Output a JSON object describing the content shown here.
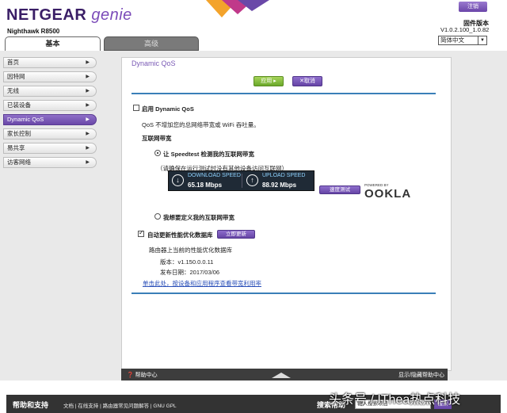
{
  "header": {
    "logo_brand": "NETGEAR",
    "logo_product": "genie",
    "model": "Nighthawk R8500",
    "logout": "注销",
    "firmware_label": "固件版本",
    "firmware_version": "V1.0.2.100_1.0.82",
    "language": "简体中文"
  },
  "tabs": {
    "basic": "基本",
    "advanced": "高级"
  },
  "sidebar": {
    "items": [
      {
        "label": "首页"
      },
      {
        "label": "因特网"
      },
      {
        "label": "无线"
      },
      {
        "label": "已装设备"
      },
      {
        "label": "Dynamic QoS",
        "active": true
      },
      {
        "label": "家长控制"
      },
      {
        "label": "易共享"
      },
      {
        "label": "访客网络"
      }
    ]
  },
  "main": {
    "title": "Dynamic QoS",
    "apply": "应用 ▸",
    "cancel": "✕取消",
    "enable_qos": "启用 Dynamic QoS",
    "enable_qos_checked": false,
    "qos_desc": "QoS 不增加您的总网络带宽或 WiFi 吞吐量。",
    "bandwidth_heading": "互联网带宽",
    "radio_speedtest": "让 Speedtest 检测我的互联网带宽",
    "radio_speedtest_checked": true,
    "speedtest_note": "（请确保在运行测试时没有其他设备访问互联网）",
    "download_label": "DOWNLOAD SPEED",
    "download_value": "65.18 Mbps",
    "upload_label": "UPLOAD SPEED",
    "upload_value": "88.92 Mbps",
    "speed_test_btn": "速度测试",
    "powered_by": "POWERED BY",
    "ookla": "OOKLA",
    "radio_custom": "我想要定义我的互联网带宽",
    "radio_custom_checked": false,
    "auto_update": "自动更新性能优化数据库",
    "auto_update_checked": true,
    "update_now": "立即更新",
    "db_on_router": "路由器上当前的性能优化数据库",
    "version": "版本：v1.150.0.0.11",
    "release_date": "发布日期：2017/03/06",
    "bandwidth_link": "单击此处，按设备和应用程序查看带宽利用率"
  },
  "helpbar": {
    "help_center": "帮助中心",
    "show_hide": "显示/隐藏帮助中心"
  },
  "bottom": {
    "support": "帮助和支持",
    "links": "文档 | 在线支持 | 路由器常见问题解答 | GNU GPL",
    "search_label": "搜索帮助",
    "search_placeholder": "输入搜索项目",
    "go": "搜索"
  },
  "watermark": "头条号 / IThea热点科技",
  "colors": {
    "accent": "#6a48a8",
    "line": "#3a7fb8",
    "apply": "#6aa82a"
  }
}
